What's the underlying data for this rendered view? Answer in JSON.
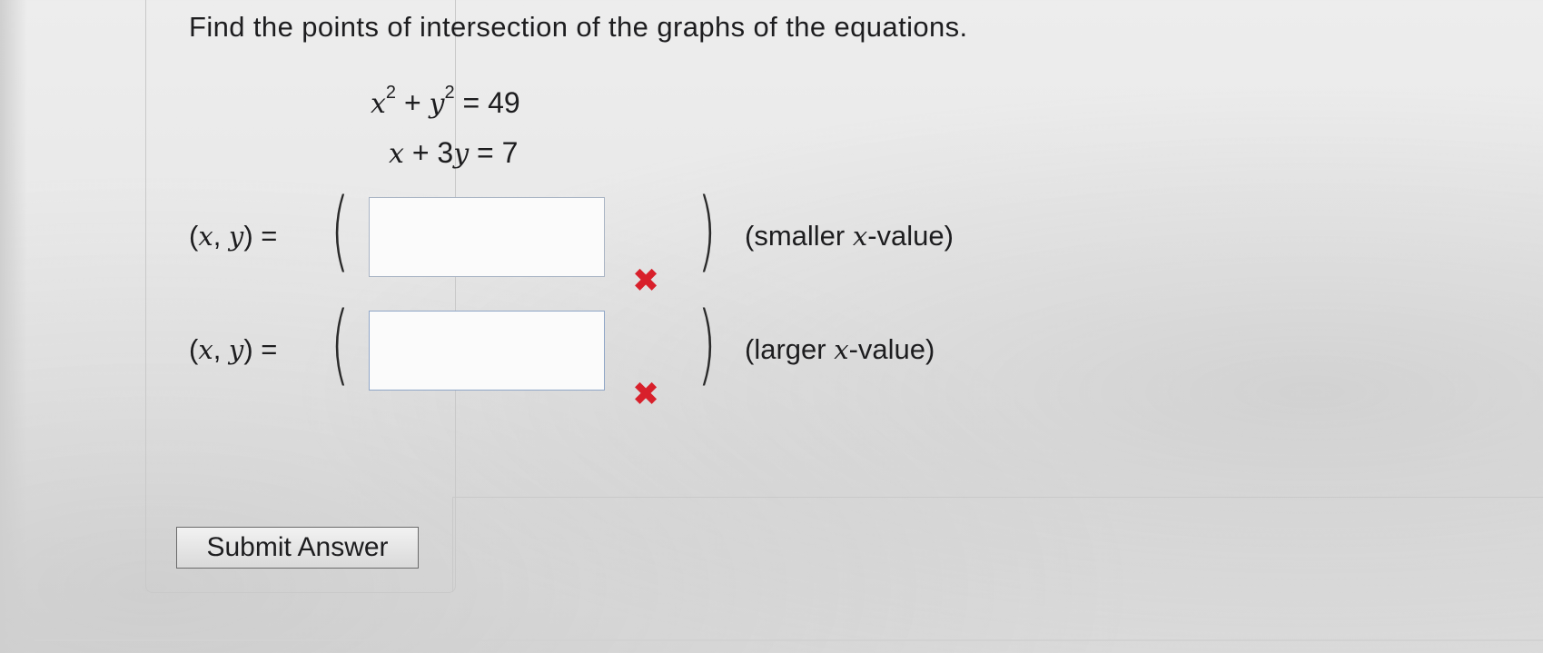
{
  "question": {
    "text": "Find the points of intersection of the graphs of the equations."
  },
  "equations": {
    "eq1": {
      "x": "x",
      "exp_x": "2",
      "plus": "+",
      "y": "y",
      "exp_y": "2",
      "rhs": "= 49"
    },
    "eq2": {
      "x": "x",
      "mid": "+ 3",
      "y": "y",
      "rhs": "= 7"
    }
  },
  "answers": {
    "label_open": "(",
    "label_x": "x",
    "label_comma": ", ",
    "label_y": "y",
    "label_close": ") =",
    "rows": [
      {
        "value": "",
        "status": "incorrect",
        "hint_open": "(smaller ",
        "hint_var": "x",
        "hint_close": "-value)"
      },
      {
        "value": "",
        "status": "incorrect",
        "hint_open": "(larger ",
        "hint_var": "x",
        "hint_close": "-value)"
      }
    ],
    "incorrect_mark": "✖",
    "paren_open": "(",
    "paren_close": ")"
  },
  "submit": {
    "label": "Submit Answer"
  },
  "colors": {
    "incorrect": "#d8202b",
    "box_border": "#a9b4c4"
  }
}
